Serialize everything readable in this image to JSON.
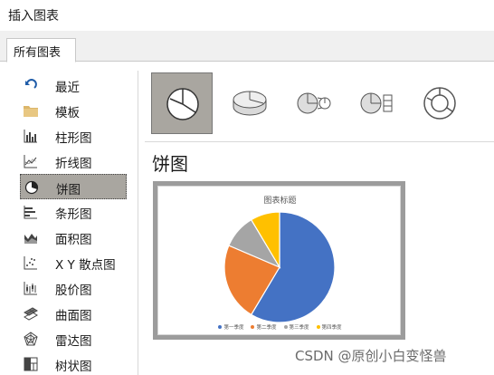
{
  "window": {
    "title": "插入图表"
  },
  "tabs": [
    {
      "label": "所有图表"
    }
  ],
  "sidebar": {
    "items": [
      {
        "label": "最近",
        "icon": "recent-arrow-icon"
      },
      {
        "label": "模板",
        "icon": "folder-icon"
      },
      {
        "label": "柱形图",
        "icon": "column-chart-icon"
      },
      {
        "label": "折线图",
        "icon": "line-chart-icon"
      },
      {
        "label": "饼图",
        "icon": "pie-chart-icon",
        "selected": true
      },
      {
        "label": "条形图",
        "icon": "bar-chart-icon"
      },
      {
        "label": "面积图",
        "icon": "area-chart-icon"
      },
      {
        "label": "X Y 散点图",
        "icon": "scatter-chart-icon"
      },
      {
        "label": "股价图",
        "icon": "stock-chart-icon"
      },
      {
        "label": "曲面图",
        "icon": "surface-chart-icon"
      },
      {
        "label": "雷达图",
        "icon": "radar-chart-icon"
      },
      {
        "label": "树状图",
        "icon": "treemap-chart-icon"
      }
    ]
  },
  "subtypes": [
    {
      "icon": "pie-icon",
      "selected": true
    },
    {
      "icon": "pie-3d-icon"
    },
    {
      "icon": "pie-of-pie-icon"
    },
    {
      "icon": "bar-of-pie-icon"
    },
    {
      "icon": "doughnut-icon"
    }
  ],
  "main": {
    "section_title": "饼图"
  },
  "colors": {
    "accent": "#4472c4",
    "selected_bg": "#a9a6a0"
  },
  "chart_data": {
    "type": "pie",
    "title": "图表标题",
    "categories": [
      "第一季度",
      "第二季度",
      "第三季度",
      "第四季度"
    ],
    "values": [
      8.2,
      3.2,
      1.4,
      1.2
    ],
    "colors": [
      "#4472c4",
      "#ed7d31",
      "#a5a5a5",
      "#ffc000"
    ],
    "legend": "bottom"
  },
  "watermark": "CSDN @原创小白变怪兽"
}
